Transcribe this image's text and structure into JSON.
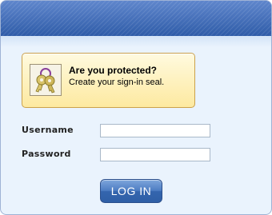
{
  "seal": {
    "title": "Are you protected?",
    "subtitle": "Create your sign-in seal.",
    "icon": "keys-icon"
  },
  "form": {
    "username_label": "Username",
    "username_value": "",
    "password_label": "Password",
    "password_value": ""
  },
  "login_button": {
    "label": "LOG IN"
  },
  "colors": {
    "header": "#3d67b3",
    "panel_bg": "#eaf3fd",
    "seal_bg": "#fde9a0",
    "seal_border": "#cba14a",
    "button": "#3465ae"
  }
}
